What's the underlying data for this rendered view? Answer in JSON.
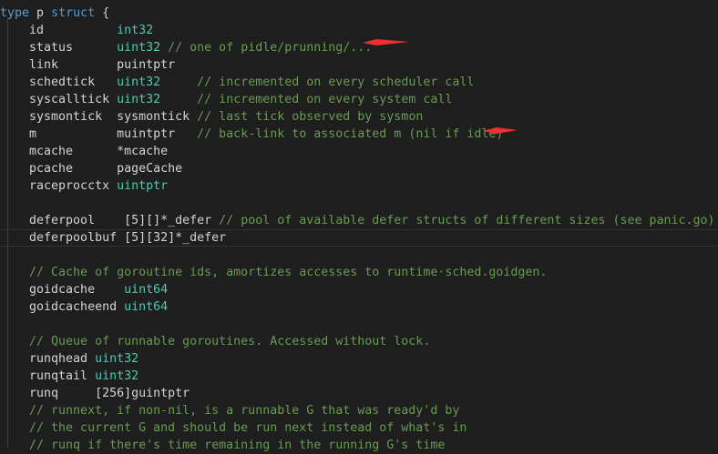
{
  "editor": {
    "colors": {
      "background": "#1e1e1e",
      "keyword": "#569cd6",
      "type": "#4ec9b0",
      "comment": "#6a9955",
      "text": "#d4d4d4",
      "annotation_arrow": "#f03030"
    },
    "lines": [
      {
        "name": "line-type-p-struct",
        "tokens": [
          [
            "kw",
            "type"
          ],
          [
            "id",
            " p "
          ],
          [
            "kw",
            "struct"
          ],
          [
            "pu",
            " {"
          ]
        ]
      },
      {
        "name": "line-field-id",
        "tokens": [
          [
            "id",
            "    id          "
          ],
          [
            "ty",
            "int32"
          ]
        ]
      },
      {
        "name": "line-field-status",
        "tokens": [
          [
            "id",
            "    status      "
          ],
          [
            "ty",
            "uint32"
          ],
          [
            "cm",
            " // one of pidle/prunning/..."
          ]
        ]
      },
      {
        "name": "line-field-link",
        "tokens": [
          [
            "id",
            "    link        puintptr"
          ]
        ]
      },
      {
        "name": "line-field-schedtick",
        "tokens": [
          [
            "id",
            "    schedtick   "
          ],
          [
            "ty",
            "uint32"
          ],
          [
            "cm",
            "     // incremented on every scheduler call"
          ]
        ]
      },
      {
        "name": "line-field-syscalltick",
        "tokens": [
          [
            "id",
            "    syscalltick "
          ],
          [
            "ty",
            "uint32"
          ],
          [
            "cm",
            "     // incremented on every system call"
          ]
        ]
      },
      {
        "name": "line-field-sysmontick",
        "tokens": [
          [
            "id",
            "    sysmontick  sysmontick "
          ],
          [
            "cm",
            "// last tick observed by sysmon"
          ]
        ]
      },
      {
        "name": "line-field-m",
        "tokens": [
          [
            "id",
            "    m           muintptr   "
          ],
          [
            "cm",
            "// back-link to associated m (nil if idle)"
          ]
        ]
      },
      {
        "name": "line-field-mcache",
        "tokens": [
          [
            "id",
            "    mcache      *mcache"
          ]
        ]
      },
      {
        "name": "line-field-pcache",
        "tokens": [
          [
            "id",
            "    pcache      pageCache"
          ]
        ]
      },
      {
        "name": "line-field-raceprocctx",
        "tokens": [
          [
            "id",
            "    raceprocctx "
          ],
          [
            "ty",
            "uintptr"
          ]
        ]
      },
      {
        "name": "line-blank-1",
        "tokens": []
      },
      {
        "name": "line-field-deferpool",
        "tokens": [
          [
            "id",
            "    deferpool    [5][]*_defer "
          ],
          [
            "cm",
            "// pool of available defer structs of different sizes (see panic.go)"
          ]
        ]
      },
      {
        "name": "line-field-deferpoolbuf",
        "current": true,
        "tokens": [
          [
            "id",
            "    deferpoolbuf [5][32]*_defer"
          ]
        ]
      },
      {
        "name": "line-blank-2",
        "tokens": []
      },
      {
        "name": "line-comment-goid-cache",
        "tokens": [
          [
            "cm",
            "    // Cache of goroutine ids, amortizes accesses to runtime·sched.goidgen."
          ]
        ]
      },
      {
        "name": "line-field-goidcache",
        "tokens": [
          [
            "id",
            "    goidcache    "
          ],
          [
            "ty",
            "uint64"
          ]
        ]
      },
      {
        "name": "line-field-goidcacheend",
        "tokens": [
          [
            "id",
            "    goidcacheend "
          ],
          [
            "ty",
            "uint64"
          ]
        ]
      },
      {
        "name": "line-blank-3",
        "tokens": []
      },
      {
        "name": "line-comment-runqueue",
        "tokens": [
          [
            "cm",
            "    // Queue of runnable goroutines. Accessed without lock."
          ]
        ]
      },
      {
        "name": "line-field-runqhead",
        "tokens": [
          [
            "id",
            "    runqhead "
          ],
          [
            "ty",
            "uint32"
          ]
        ]
      },
      {
        "name": "line-field-runqtail",
        "tokens": [
          [
            "id",
            "    runqtail "
          ],
          [
            "ty",
            "uint32"
          ]
        ]
      },
      {
        "name": "line-field-runq",
        "tokens": [
          [
            "id",
            "    runq     [256]guintptr"
          ]
        ]
      },
      {
        "name": "line-comment-runnext-1",
        "tokens": [
          [
            "cm",
            "    // runnext, if non-nil, is a runnable G that was ready'd by"
          ]
        ]
      },
      {
        "name": "line-comment-runnext-2",
        "tokens": [
          [
            "cm",
            "    // the current G and should be run next instead of what's in"
          ]
        ]
      },
      {
        "name": "line-comment-runnext-3",
        "tokens": [
          [
            "cm",
            "    // runq if there's time remaining in the running G's time"
          ]
        ]
      }
    ],
    "annotations": [
      {
        "name": "arrow-annotation-status",
        "points_to": "line-field-status"
      },
      {
        "name": "arrow-annotation-m",
        "points_to": "line-field-m"
      }
    ]
  }
}
